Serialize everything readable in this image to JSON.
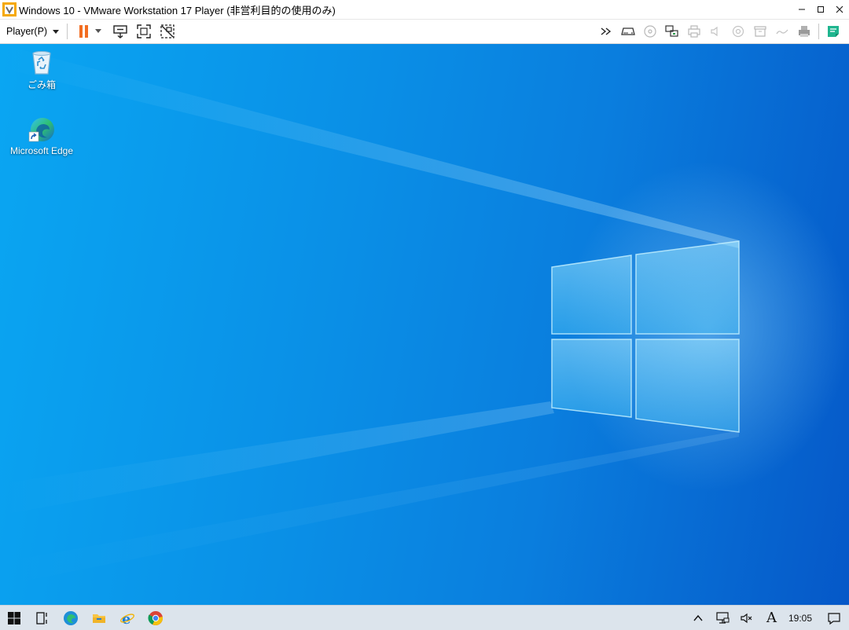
{
  "window": {
    "title": "Windows 10 - VMware Workstation 17 Player (非営利目的の使用のみ)",
    "controls": [
      "minimize-icon",
      "maximize-icon",
      "close-icon"
    ]
  },
  "toolbar": {
    "player_menu_label": "Player(P)",
    "left_icons": [
      "pause-icon",
      "dropdown-icon",
      "send-ctrl-alt-del-icon",
      "fullscreen-icon",
      "unity-icon"
    ],
    "right_icons": [
      "expand-icon",
      "hard-disk-icon",
      "cd-dvd-icon",
      "network-adapter-icon",
      "printer-icon",
      "audio-icon",
      "usb-icon",
      "floppy-icon",
      "message-icon",
      "shared-printer-icon",
      "notes-icon"
    ]
  },
  "desktop": {
    "icons": [
      {
        "label": "ごみ箱",
        "icon": "recycle-bin-icon"
      },
      {
        "label": "Microsoft Edge",
        "icon": "edge-shortcut-icon"
      }
    ]
  },
  "taskbar": {
    "apps": [
      "start-icon",
      "task-view-icon",
      "edge-icon",
      "file-explorer-icon",
      "internet-explorer-icon",
      "chrome-icon"
    ],
    "tray_icons": [
      "show-hidden-icons-icon",
      "network-icon",
      "volume-muted-icon"
    ],
    "ime_indicator": "A",
    "clock": "19:05",
    "notification_icon": "action-center-icon"
  },
  "colors": {
    "vmware_accent": "#f26d21",
    "desktop_blue": "#0a8fe6",
    "taskbar_bg": "#dce4ec"
  }
}
